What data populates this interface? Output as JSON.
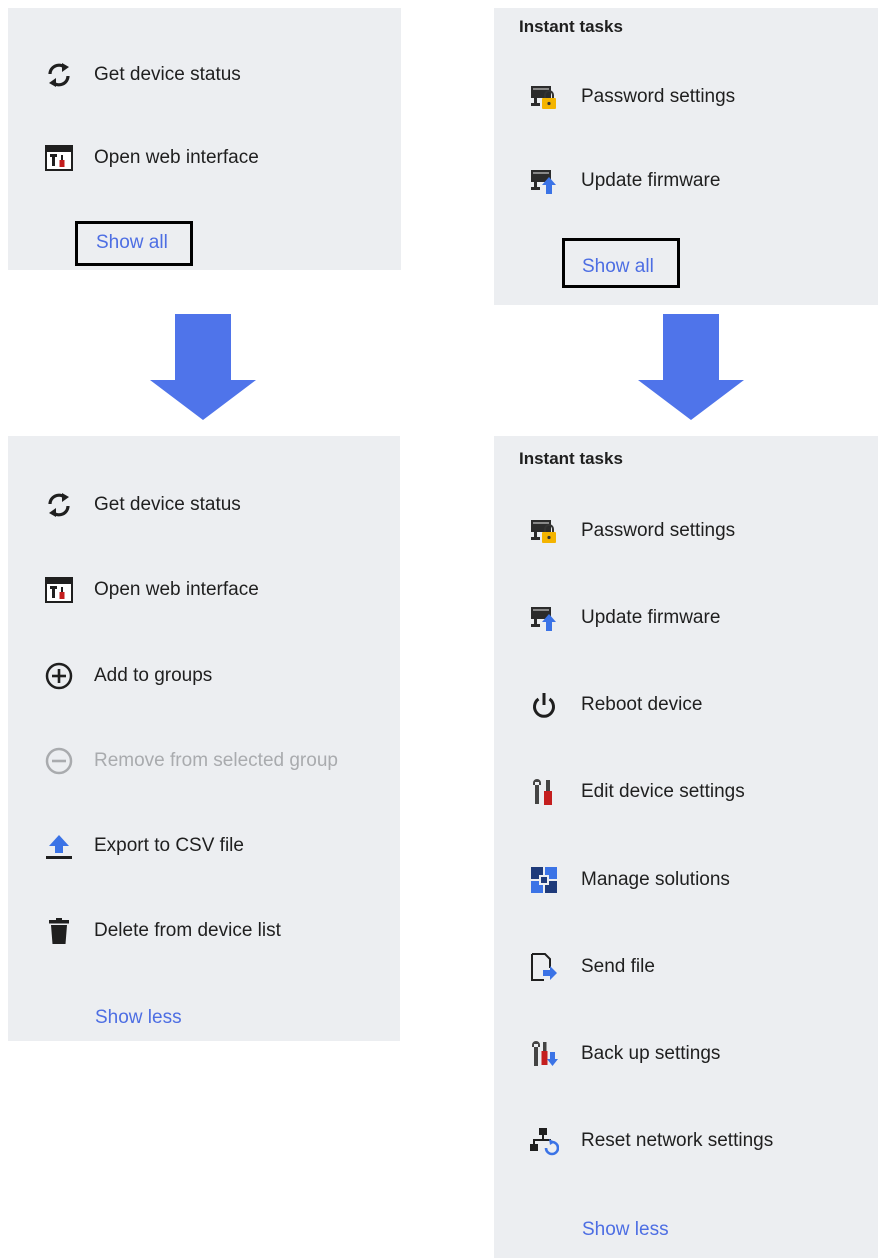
{
  "panels": {
    "top_left": {
      "items": [
        {
          "label": "Get device status",
          "icon": "refresh-icon"
        },
        {
          "label": "Open web interface",
          "icon": "web-interface-icon"
        }
      ],
      "toggle_label": "Show all"
    },
    "top_right": {
      "heading": "Instant tasks",
      "items": [
        {
          "label": "Password settings",
          "icon": "password-settings-icon"
        },
        {
          "label": "Update firmware",
          "icon": "update-firmware-icon"
        }
      ],
      "toggle_label": "Show all"
    },
    "bottom_left": {
      "items": [
        {
          "label": "Get device status",
          "icon": "refresh-icon"
        },
        {
          "label": "Open web interface",
          "icon": "web-interface-icon"
        },
        {
          "label": "Add to groups",
          "icon": "plus-circle-icon"
        },
        {
          "label": "Remove from selected group",
          "icon": "minus-circle-icon",
          "disabled": true
        },
        {
          "label": "Export to CSV file",
          "icon": "export-icon"
        },
        {
          "label": "Delete from device list",
          "icon": "trash-icon"
        }
      ],
      "toggle_label": "Show less"
    },
    "bottom_right": {
      "heading": "Instant tasks",
      "items": [
        {
          "label": "Password settings",
          "icon": "password-settings-icon"
        },
        {
          "label": "Update firmware",
          "icon": "update-firmware-icon"
        },
        {
          "label": "Reboot device",
          "icon": "power-icon"
        },
        {
          "label": "Edit device settings",
          "icon": "tools-icon"
        },
        {
          "label": "Manage solutions",
          "icon": "puzzle-icon"
        },
        {
          "label": "Send file",
          "icon": "send-file-icon"
        },
        {
          "label": "Back up settings",
          "icon": "backup-settings-icon"
        },
        {
          "label": "Reset network settings",
          "icon": "network-reset-icon"
        }
      ],
      "toggle_label": "Show less"
    }
  },
  "colors": {
    "panel_bg": "#eceef1",
    "link": "#4d6ee3",
    "arrow": "#4f74ea",
    "disabled_text": "#a9abae",
    "accent_blue": "#3b73e6",
    "accent_yellow": "#f4b400",
    "accent_red": "#c41e1e"
  }
}
